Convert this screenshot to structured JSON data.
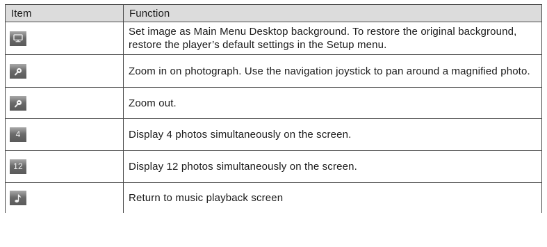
{
  "table": {
    "headers": {
      "item": "Item",
      "function": "Function"
    },
    "rows": [
      {
        "icon": "desktop-monitor-icon",
        "text": "Set image as Main Menu Desktop background. To restore the original background, restore the player’s default settings in the Setup menu."
      },
      {
        "icon": "zoom-in-magnifier-icon",
        "text": "Zoom in on photograph. Use the navigation joystick to pan around a magnified photo."
      },
      {
        "icon": "zoom-out-magnifier-icon",
        "text": "Zoom out."
      },
      {
        "icon": "grid-4-icon",
        "label": "4",
        "text": "Display 4 photos simultaneously on the screen."
      },
      {
        "icon": "grid-12-icon",
        "label": "12",
        "text": "Display 12 photos simultaneously on the screen."
      },
      {
        "icon": "music-note-icon",
        "text": "Return to music playback screen"
      }
    ]
  },
  "colors": {
    "header_background": "#dcdcdc",
    "border": "#4a4a4a",
    "icon_background": "#676767",
    "icon_glyph": "#f2f2f2"
  }
}
